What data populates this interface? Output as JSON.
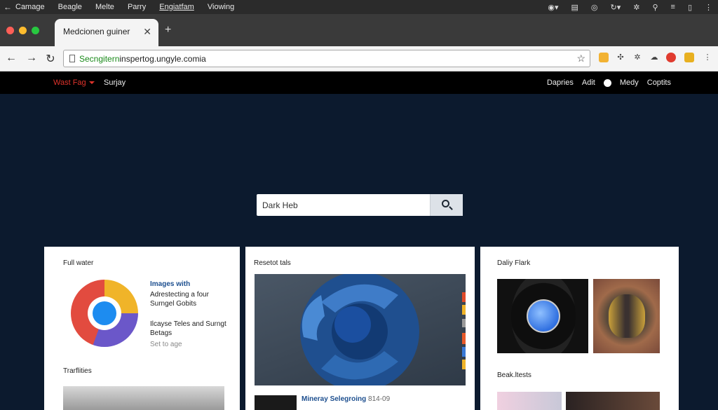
{
  "os": {
    "back_glyph": "←",
    "menu": [
      "Camage",
      "Beagle",
      "Melte",
      "Parry",
      "Engiatfam",
      "Viowing"
    ],
    "right_icons": [
      "compass-icon",
      "window-icon",
      "globe-icon",
      "sync-icon",
      "gear-icon",
      "search-icon",
      "menu-icon",
      "copy-icon",
      "more-icon"
    ]
  },
  "browser": {
    "tab_title": "Medcionen guiner",
    "tab_close": "✕",
    "new_tab": "+",
    "url_secure": "Secngitern",
    "url_rest": "inspertog.ungyle.comia"
  },
  "site": {
    "brand": "Wast Fag",
    "nav_item": "Surjay",
    "links": [
      "Dapries",
      "Adit",
      "Medy",
      "Coptits"
    ]
  },
  "search": {
    "value": "Dark Heb"
  },
  "cards": {
    "card1": {
      "title": "Full water",
      "link": "Images with",
      "desc1": "Adrestecting a four Surngel Gobits",
      "desc2": "Ilcayse Teles and Surngt Betags",
      "meta": "Set to age",
      "section": "Trarflities"
    },
    "card2": {
      "title": "Resetot tals",
      "caption": "Mineray Selegroing",
      "caption_date": "814-09"
    },
    "card3": {
      "title": "Daliy Flark",
      "section": "Beak.ltests"
    }
  },
  "colors": {
    "page_bg": "#0c1a2e",
    "brand_red": "#e0332b",
    "link_blue": "#1d4f8f"
  }
}
